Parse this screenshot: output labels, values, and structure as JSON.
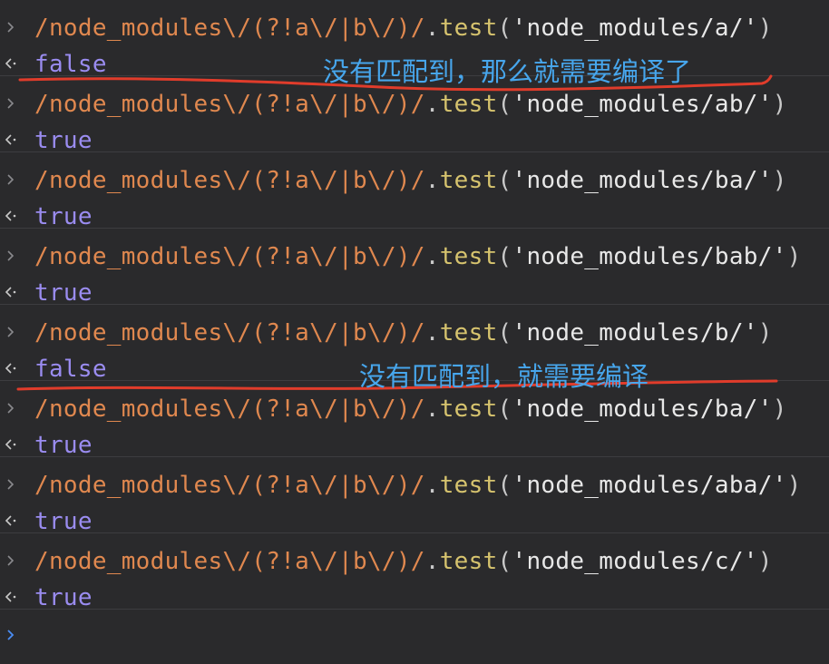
{
  "console": {
    "accent_colors": {
      "regex": "#e0884f",
      "method": "#d6c36e",
      "boolean": "#9a8cf0",
      "annotation": "#47a6ec",
      "underline": "#e03c2b",
      "prompt": "#4a8df5"
    },
    "entries": [
      {
        "regex": "/node_modules\\/(?!a\\/|b\\/)/",
        "dot": ".",
        "method": "test",
        "open": "(",
        "string": "'node_modules/a/'",
        "close": ")",
        "result": "false"
      },
      {
        "regex": "/node_modules\\/(?!a\\/|b\\/)/",
        "dot": ".",
        "method": "test",
        "open": "(",
        "string": "'node_modules/ab/'",
        "close": ")",
        "result": "true"
      },
      {
        "regex": "/node_modules\\/(?!a\\/|b\\/)/",
        "dot": ".",
        "method": "test",
        "open": "(",
        "string": "'node_modules/ba/'",
        "close": ")",
        "result": "true"
      },
      {
        "regex": "/node_modules\\/(?!a\\/|b\\/)/",
        "dot": ".",
        "method": "test",
        "open": "(",
        "string": "'node_modules/bab/'",
        "close": ")",
        "result": "true"
      },
      {
        "regex": "/node_modules\\/(?!a\\/|b\\/)/",
        "dot": ".",
        "method": "test",
        "open": "(",
        "string": "'node_modules/b/'",
        "close": ")",
        "result": "false"
      },
      {
        "regex": "/node_modules\\/(?!a\\/|b\\/)/",
        "dot": ".",
        "method": "test",
        "open": "(",
        "string": "'node_modules/ba/'",
        "close": ")",
        "result": "true"
      },
      {
        "regex": "/node_modules\\/(?!a\\/|b\\/)/",
        "dot": ".",
        "method": "test",
        "open": "(",
        "string": "'node_modules/aba/'",
        "close": ")",
        "result": "true"
      },
      {
        "regex": "/node_modules\\/(?!a\\/|b\\/)/",
        "dot": ".",
        "method": "test",
        "open": "(",
        "string": "'node_modules/c/'",
        "close": ")",
        "result": "true"
      }
    ],
    "annotations": [
      {
        "text": "没有匹配到，那么就需要编译了"
      },
      {
        "text": "没有匹配到，就需要编译"
      }
    ],
    "icons": {
      "input_arrow": "chevron-right-icon",
      "output_arrow": "return-arrow-icon",
      "prompt": "prompt-chevron-icon"
    }
  }
}
